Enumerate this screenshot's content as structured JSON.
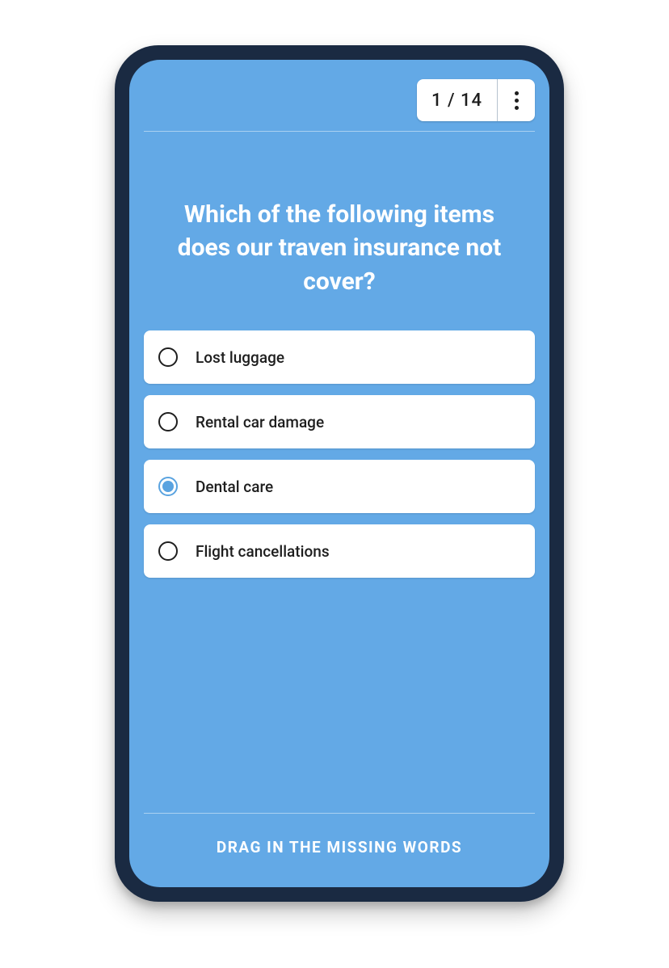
{
  "colors": {
    "accent": "#63a9e6",
    "frame": "#1a2a42",
    "white": "#ffffff",
    "text_dark": "#1e1e1e"
  },
  "header": {
    "progress_label": "1 / 14"
  },
  "question": {
    "text": "Which of the following items does our traven insurance not cover?"
  },
  "options": [
    {
      "label": "Lost luggage",
      "selected": false
    },
    {
      "label": "Rental car damage",
      "selected": false
    },
    {
      "label": "Dental care",
      "selected": true
    },
    {
      "label": "Flight cancellations",
      "selected": false
    }
  ],
  "footer": {
    "hint": "DRAG IN THE MISSING WORDS"
  }
}
